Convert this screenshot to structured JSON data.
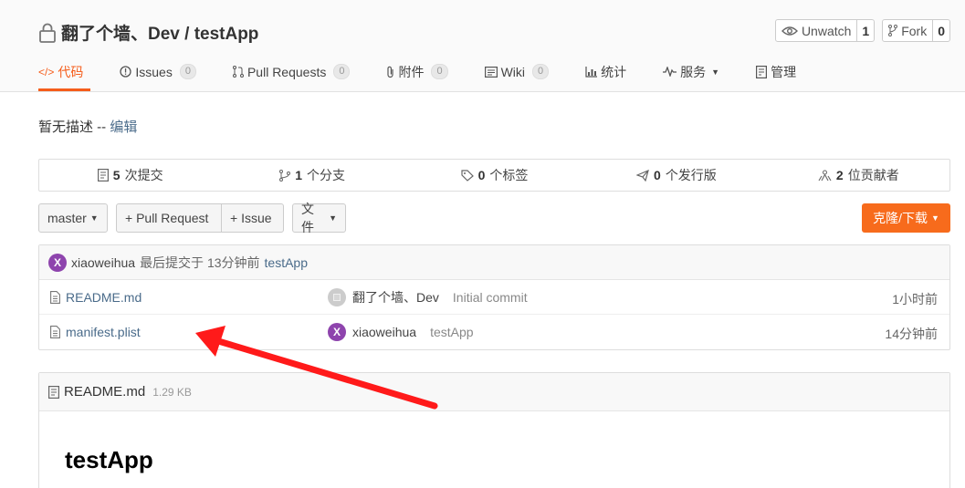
{
  "repo": {
    "title": "翻了个墙、Dev / testApp",
    "watch_label": "Unwatch",
    "watch_count": "1",
    "fork_label": "Fork",
    "fork_count": "0"
  },
  "tabs": [
    {
      "label": "代码",
      "icon": "code-icon"
    },
    {
      "label": "Issues",
      "count": "0",
      "icon": "issues-icon"
    },
    {
      "label": "Pull Requests",
      "count": "0",
      "icon": "pull-request-icon"
    },
    {
      "label": "附件",
      "count": "0",
      "icon": "attachment-icon"
    },
    {
      "label": "Wiki",
      "count": "0",
      "icon": "wiki-icon"
    },
    {
      "label": "统计",
      "icon": "stats-icon"
    },
    {
      "label": "服务",
      "icon": "service-icon"
    },
    {
      "label": "管理",
      "icon": "manage-icon"
    }
  ],
  "description": {
    "text": "暂无描述 -- ",
    "edit_link": "编辑"
  },
  "stats": [
    {
      "count": "5",
      "label": "次提交",
      "icon": "commit-icon"
    },
    {
      "count": "1",
      "label": "个分支",
      "icon": "branch-icon"
    },
    {
      "count": "0",
      "label": "个标签",
      "icon": "tag-icon"
    },
    {
      "count": "0",
      "label": "个发行版",
      "icon": "release-icon"
    },
    {
      "count": "2",
      "label": "位贡献者",
      "icon": "contributors-icon"
    }
  ],
  "toolbar": {
    "branch": "master",
    "pull_request": "+ Pull Request",
    "issue": "+ Issue",
    "file_menu": "文件",
    "clone": "克隆/下载"
  },
  "latest_commit": {
    "avatar": "X",
    "user": "xiaoweihua",
    "text": "最后提交于 13分钟前",
    "message": "testApp"
  },
  "files": [
    {
      "name": "README.md",
      "author": "翻了个墙、Dev",
      "message": "Initial commit",
      "time": "1小时前",
      "avatar": ""
    },
    {
      "name": "manifest.plist",
      "author": "xiaoweihua",
      "message": "testApp",
      "time": "14分钟前",
      "avatar": "X"
    }
  ],
  "readme": {
    "filename": "README.md",
    "size": "1.29 KB",
    "heading": "testApp"
  },
  "colors": {
    "accent": "#f55d1b",
    "link": "#4a6b8a",
    "avatar": "#8e44ad",
    "annotation_arrow": "#ff1a1a"
  }
}
